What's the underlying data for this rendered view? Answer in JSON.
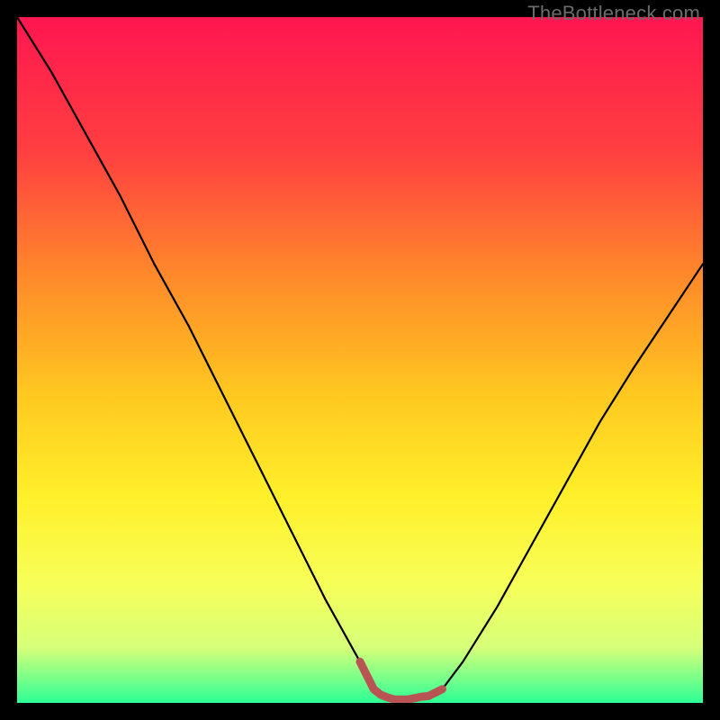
{
  "watermark": "TheBottleneck.com",
  "colors": {
    "black": "#000000",
    "curve_stroke": "#000000",
    "marker_stroke": "#b85454",
    "gradient": {
      "top": "#ff1650",
      "mid1": "#ff4040",
      "mid2": "#ff8a2a",
      "mid3": "#ffc820",
      "mid4": "#fff02a",
      "mid5": "#f6ff5a",
      "mid6": "#d6ff7a",
      "bottom": "#2cff96"
    }
  },
  "chart_data": {
    "type": "line",
    "title": "",
    "xlabel": "",
    "ylabel": "",
    "xlim": [
      0,
      100
    ],
    "ylim": [
      0,
      100
    ],
    "series": [
      {
        "name": "bottleneck-curve",
        "x": [
          0,
          5,
          10,
          15,
          20,
          25,
          30,
          35,
          40,
          45,
          50,
          52,
          55,
          57,
          60,
          62,
          65,
          70,
          75,
          80,
          85,
          90,
          95,
          100
        ],
        "values": [
          100,
          92,
          83,
          74,
          64,
          55,
          45,
          35,
          25,
          15,
          6,
          2,
          0.5,
          0.5,
          1,
          2,
          6,
          14,
          23,
          32,
          41,
          49,
          56.5,
          64
        ]
      }
    ],
    "annotations": [
      {
        "name": "optimal-zone-marker",
        "x": [
          50,
          52,
          53,
          54,
          55,
          56,
          57,
          58,
          59,
          60,
          62
        ],
        "values": [
          6,
          2,
          1.2,
          0.8,
          0.5,
          0.5,
          0.5,
          0.7,
          0.9,
          1,
          2
        ]
      }
    ]
  }
}
